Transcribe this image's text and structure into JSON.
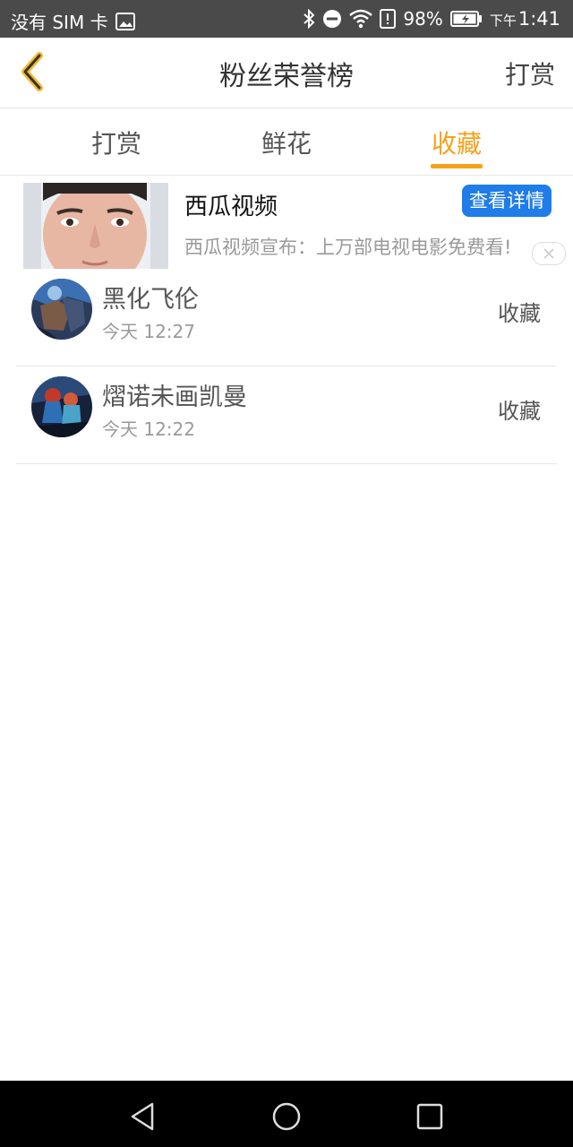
{
  "status_bar": {
    "carrier": "没有 SIM 卡",
    "battery_percent": "98%",
    "time_prefix": "下午",
    "time": "1:41",
    "icons": [
      "image-icon",
      "bluetooth-icon",
      "dnd-icon",
      "wifi-icon",
      "alert-icon",
      "battery-icon"
    ]
  },
  "header": {
    "title": "粉丝荣誉榜",
    "right_action": "打赏"
  },
  "tabs": [
    {
      "label": "打赏",
      "active": false
    },
    {
      "label": "鲜花",
      "active": false
    },
    {
      "label": "收藏",
      "active": true
    }
  ],
  "ad": {
    "title": "西瓜视频",
    "button": "查看详情",
    "description": "西瓜视频宣布：上万部电视电影免费看!"
  },
  "list": [
    {
      "name": "黑化飞伦",
      "time": "今天 12:27",
      "action": "收藏"
    },
    {
      "name": "熠诺未画凯曼",
      "time": "今天 12:22",
      "action": "收藏"
    }
  ],
  "colors": {
    "accent": "#f5a21b",
    "ad_button": "#1f7ce8",
    "status_bar": "#4a4a4a"
  }
}
